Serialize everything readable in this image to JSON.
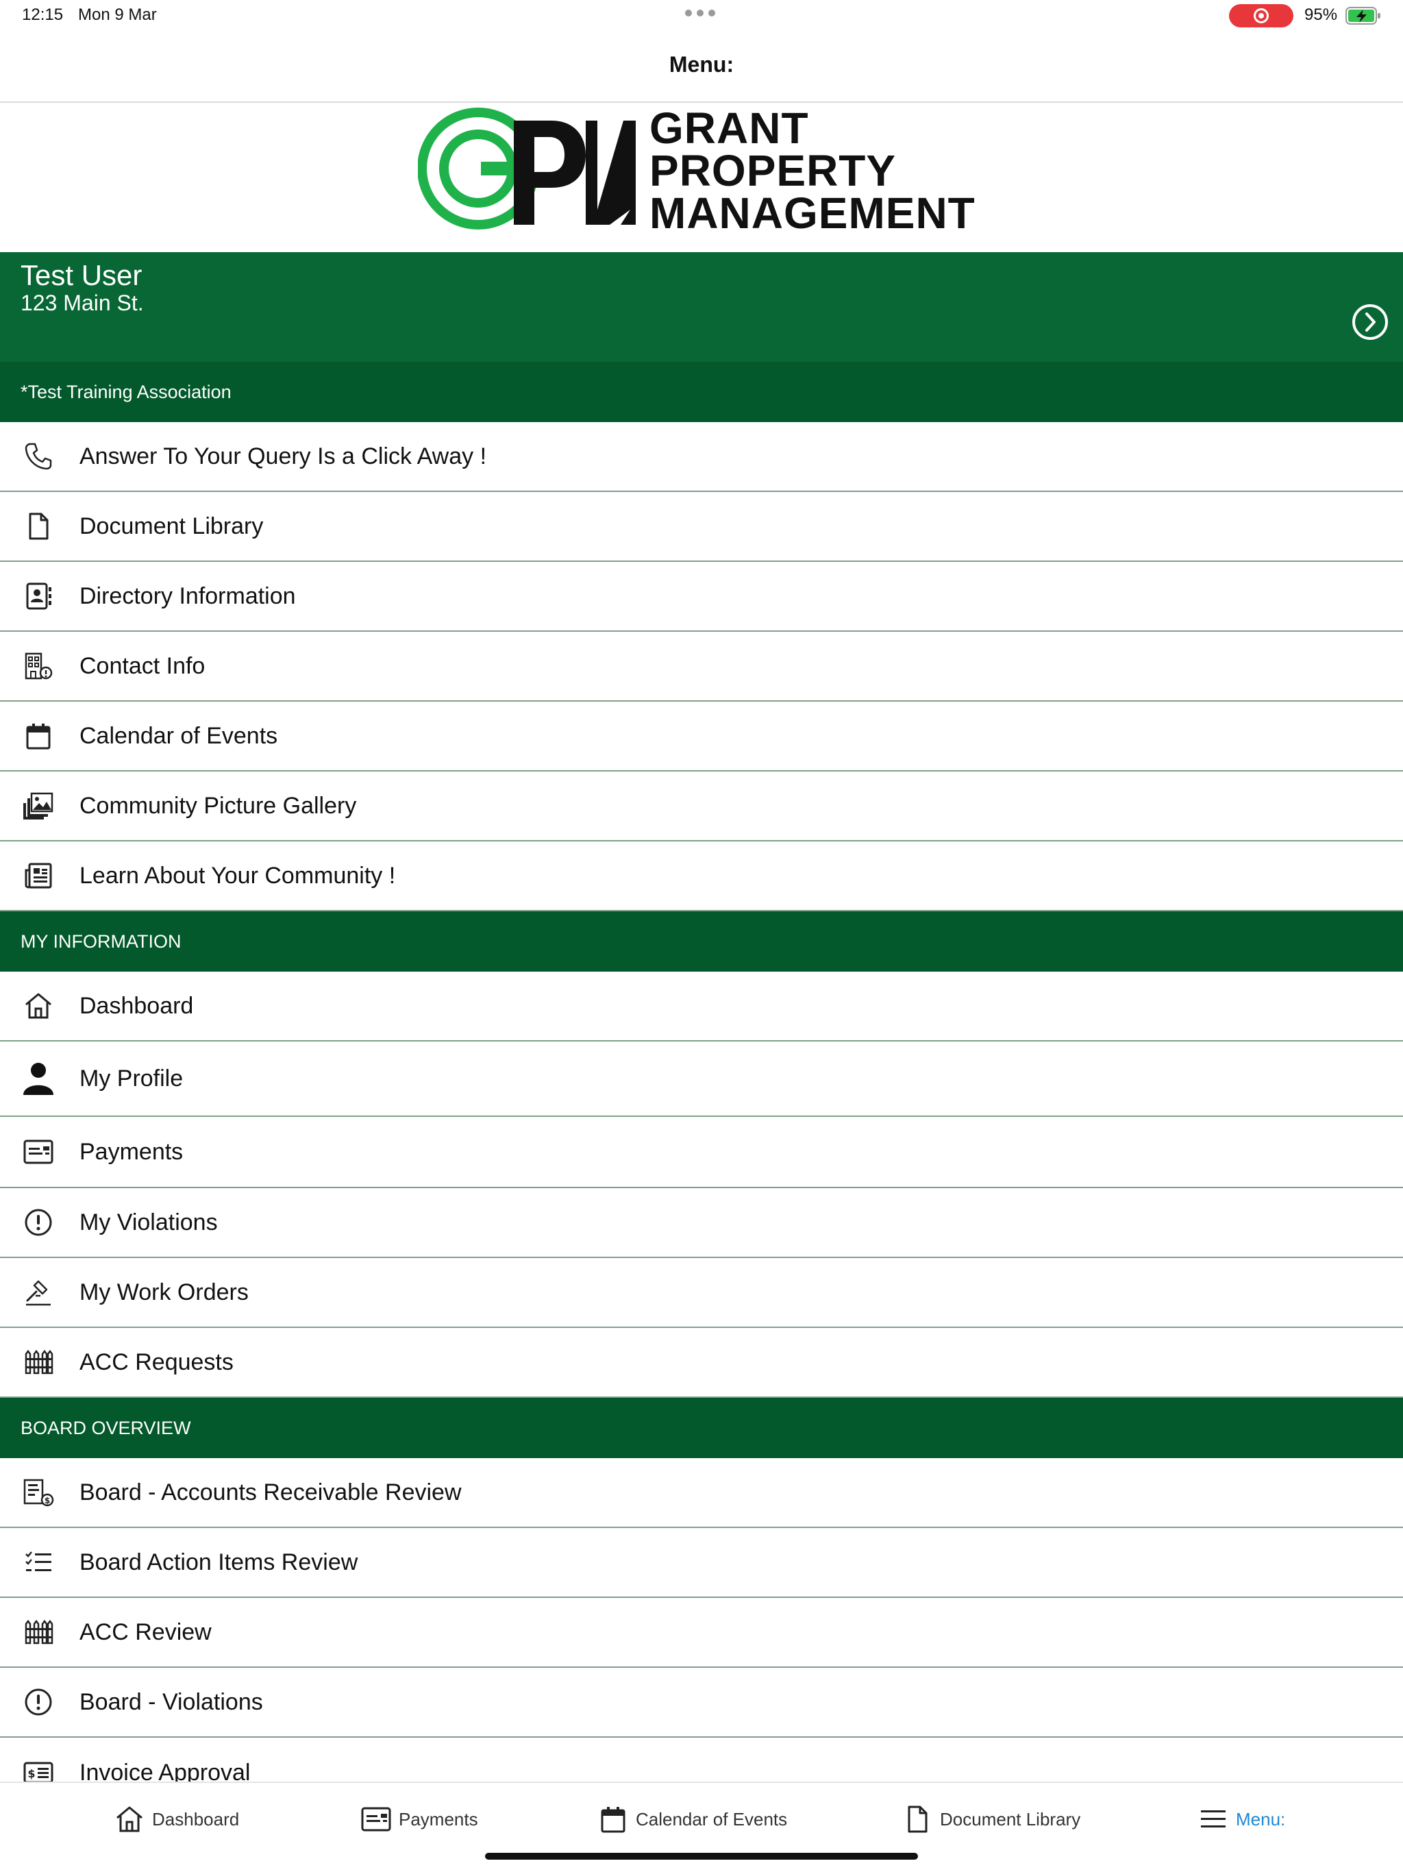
{
  "status_bar": {
    "time": "12:15",
    "date": "Mon 9 Mar",
    "battery": "95%"
  },
  "header": {
    "title": "Menu:"
  },
  "logo": {
    "line1": "GRANT",
    "line2": "PROPERTY",
    "line3": "MANAGEMENT"
  },
  "user": {
    "name": "Test User",
    "address": "123 Main St."
  },
  "association": {
    "label": "*Test Training Association"
  },
  "community_items": [
    {
      "label": "Answer To Your Query Is a Click Away !",
      "icon": "phone-icon"
    },
    {
      "label": "Document Library",
      "icon": "document-icon"
    },
    {
      "label": "Directory Information",
      "icon": "contact-book-icon"
    },
    {
      "label": "Contact Info",
      "icon": "building-info-icon"
    },
    {
      "label": "Calendar of Events",
      "icon": "calendar-icon"
    },
    {
      "label": "Community Picture Gallery",
      "icon": "gallery-icon"
    },
    {
      "label": "Learn About Your Community !",
      "icon": "newspaper-icon"
    }
  ],
  "my_information": {
    "title": "MY INFORMATION",
    "items": [
      {
        "label": "Dashboard",
        "icon": "home-icon"
      },
      {
        "label": "My Profile",
        "icon": "person-icon"
      },
      {
        "label": "Payments",
        "icon": "payment-card-icon"
      },
      {
        "label": "My Violations",
        "icon": "alert-circle-icon"
      },
      {
        "label": "My Work Orders",
        "icon": "hammer-icon"
      },
      {
        "label": "ACC Requests",
        "icon": "fence-icon"
      }
    ]
  },
  "board_overview": {
    "title": "BOARD OVERVIEW",
    "items": [
      {
        "label": "Board - Accounts Receivable Review",
        "icon": "receivable-icon"
      },
      {
        "label": "Board Action Items Review",
        "icon": "checklist-icon"
      },
      {
        "label": "ACC Review",
        "icon": "fence-icon"
      },
      {
        "label": "Board - Violations",
        "icon": "alert-circle-icon"
      },
      {
        "label": "Invoice Approval",
        "icon": "invoice-icon"
      }
    ]
  },
  "tab_bar": {
    "tabs": [
      {
        "label": "Dashboard",
        "icon": "home-icon"
      },
      {
        "label": "Payments",
        "icon": "payment-card-icon"
      },
      {
        "label": "Calendar of Events",
        "icon": "calendar-icon"
      },
      {
        "label": "Document Library",
        "icon": "document-icon"
      },
      {
        "label": "Menu:",
        "icon": "menu-icon",
        "active": true
      }
    ]
  },
  "colors": {
    "banner_green": "#086734",
    "section_green": "#03592b",
    "logo_green": "#1fb24a",
    "active_tab": "#1e88d6",
    "record_red": "#e8373a"
  }
}
